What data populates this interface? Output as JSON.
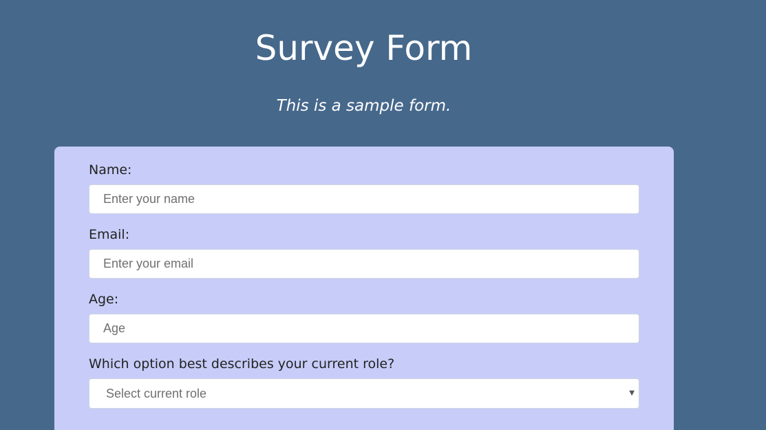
{
  "header": {
    "title": "Survey Form",
    "description": "This is a sample form."
  },
  "form": {
    "name": {
      "label": "Name:",
      "placeholder": "Enter your name"
    },
    "email": {
      "label": "Email:",
      "placeholder": "Enter your email"
    },
    "age": {
      "label": "Age:",
      "placeholder": "Age"
    },
    "role": {
      "label": "Which option best describes your current role?",
      "selected": "Select current role",
      "icon": "chevron-down-icon"
    }
  },
  "colors": {
    "page_background": "#46688b",
    "form_background": "#c7cdf8",
    "input_background": "#ffffff"
  }
}
